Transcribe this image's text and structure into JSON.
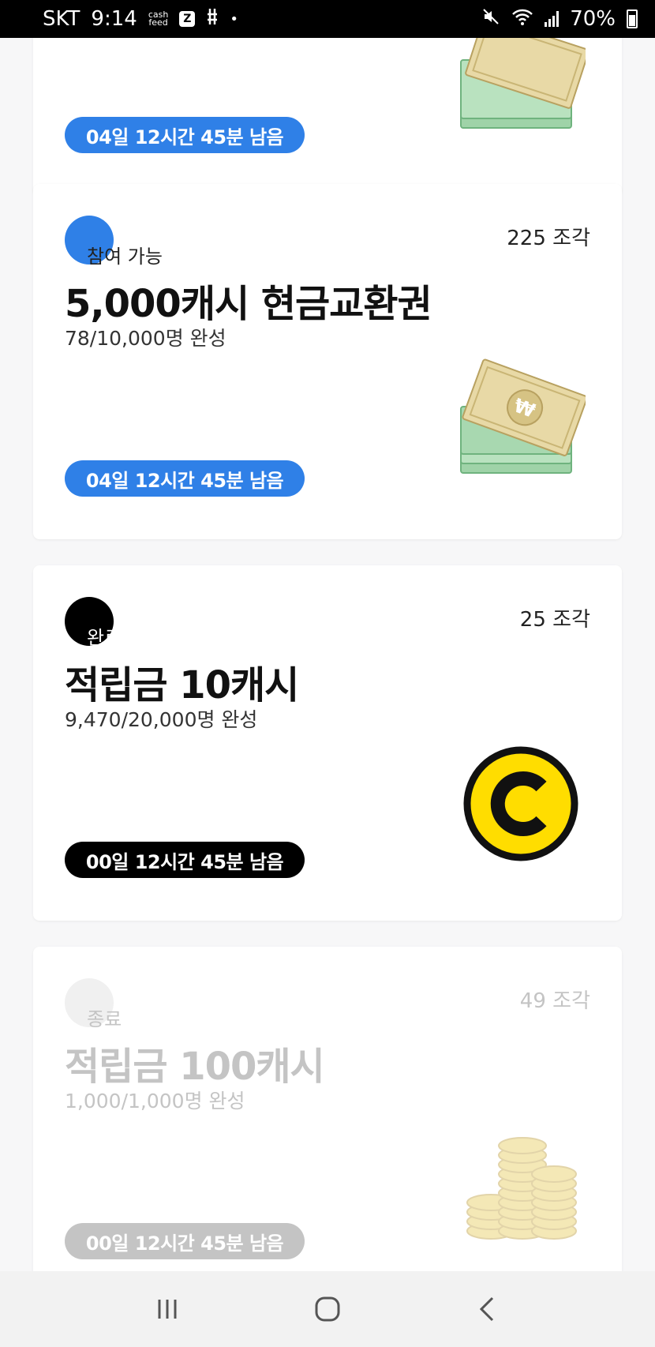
{
  "status_bar": {
    "carrier": "SKT",
    "time": "9:14",
    "app_badge_line1": "cash",
    "app_badge_line2": "feed",
    "z_badge": "Z",
    "notification_dot": "•",
    "battery": "70%"
  },
  "cards": [
    {
      "timer": "04일 12시간 45분 남음",
      "accent": "#2f80e7"
    },
    {
      "status": "참여 가능",
      "pieces": "225 조각",
      "title": "5,000캐시 현금교환권",
      "progress": "78/10,000명 완성",
      "timer": "04일 12시간 45분 남음",
      "accent": "#2f80e7",
      "prize_icon": "cash-bills-icon"
    },
    {
      "status": "완료",
      "pieces": "25 조각",
      "title": "적립금 10캐시",
      "progress": "9,470/20,000명 완성",
      "timer": "00일 12시간 45분 남음",
      "accent": "#000000",
      "prize_icon": "cash-coin-icon"
    },
    {
      "status": "종료",
      "pieces": "49 조각",
      "title": "적립금 100캐시",
      "progress": "1,000/1,000명 완성",
      "timer": "00일 12시간 45분 남음",
      "accent": "#c4c4c4",
      "prize_icon": "coin-stack-icon"
    }
  ],
  "nav_bar": {
    "recent_icon": "recent-apps-icon",
    "home_icon": "home-icon",
    "back_icon": "back-icon"
  }
}
